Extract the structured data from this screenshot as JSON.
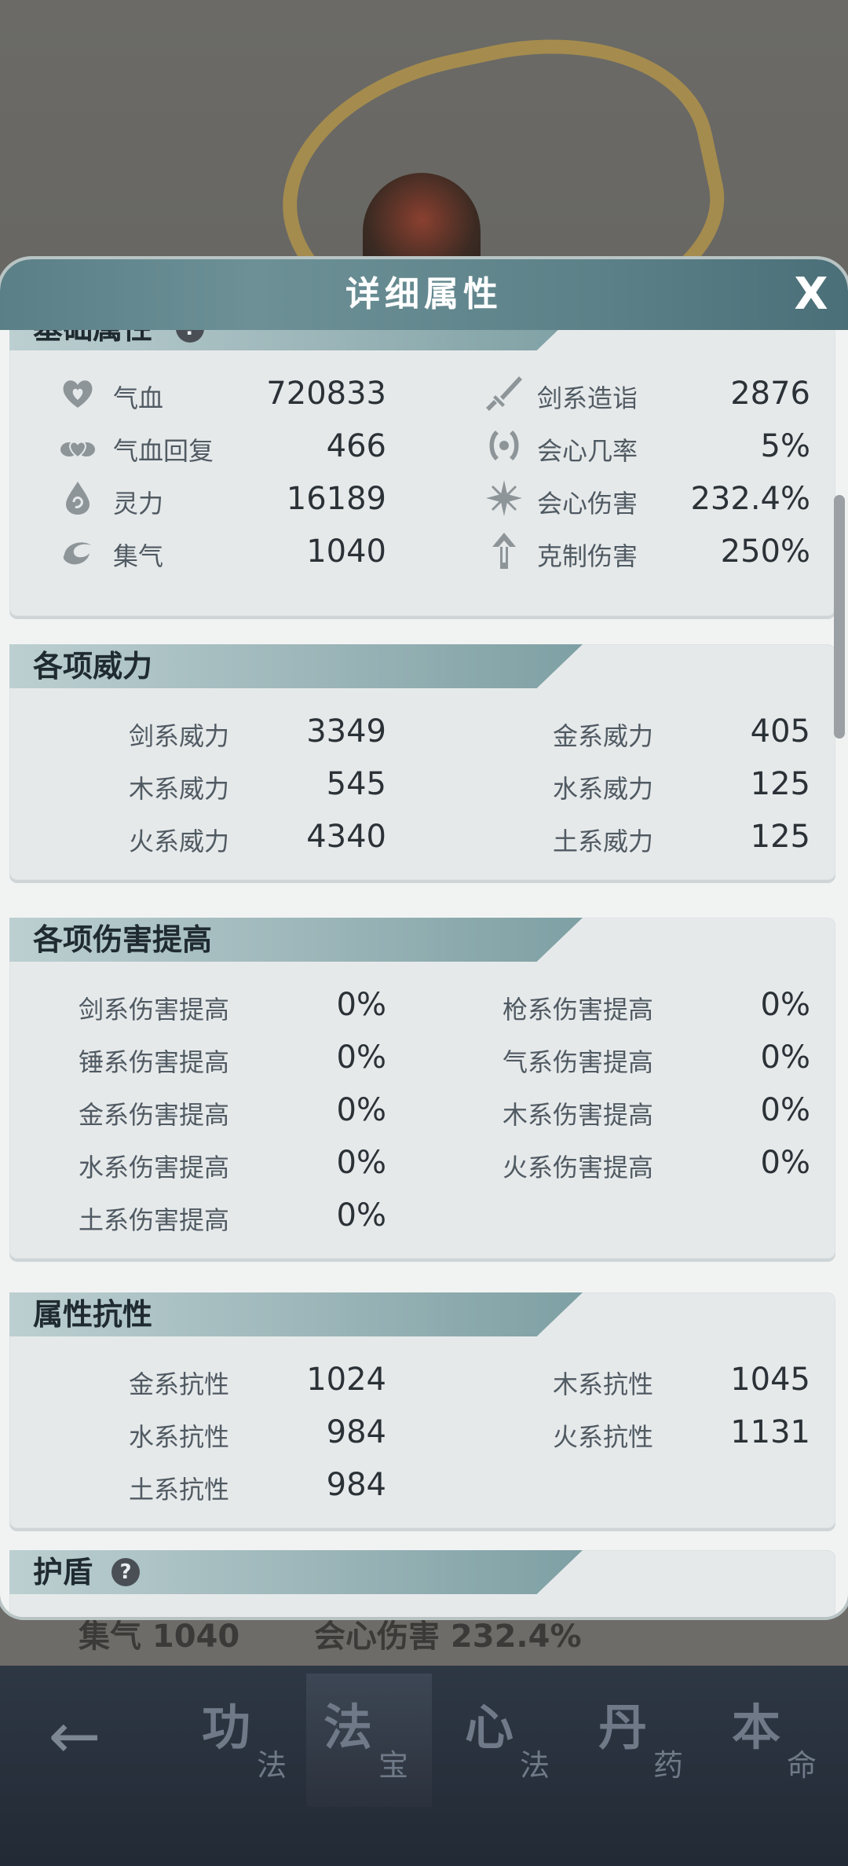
{
  "modal": {
    "title": "详细属性",
    "close": "X"
  },
  "basic": {
    "title": "基础属性",
    "help": "?",
    "left": [
      {
        "icon": "heart-icon",
        "label": "气血",
        "value": "720833"
      },
      {
        "icon": "cloud-heart-icon",
        "label": "气血回复",
        "value": "466"
      },
      {
        "icon": "spirit-drop-icon",
        "label": "灵力",
        "value": "16189"
      },
      {
        "icon": "swirl-icon",
        "label": "集气",
        "value": "1040"
      }
    ],
    "right": [
      {
        "icon": "sword-icon",
        "label": "剑系造诣",
        "value": "2876"
      },
      {
        "icon": "crit-rate-icon",
        "label": "会心几率",
        "value": "5%"
      },
      {
        "icon": "crit-damage-icon",
        "label": "会心伤害",
        "value": "232.4%"
      },
      {
        "icon": "counter-arrow-icon",
        "label": "克制伤害",
        "value": "250%"
      }
    ]
  },
  "power": {
    "title": "各项威力",
    "left": [
      {
        "label": "剑系威力",
        "value": "3349"
      },
      {
        "label": "木系威力",
        "value": "545"
      },
      {
        "label": "火系威力",
        "value": "4340"
      }
    ],
    "right": [
      {
        "label": "金系威力",
        "value": "405"
      },
      {
        "label": "水系威力",
        "value": "125"
      },
      {
        "label": "土系威力",
        "value": "125"
      }
    ]
  },
  "damage": {
    "title": "各项伤害提高",
    "left": [
      {
        "label": "剑系伤害提高",
        "value": "0%"
      },
      {
        "label": "锤系伤害提高",
        "value": "0%"
      },
      {
        "label": "金系伤害提高",
        "value": "0%"
      },
      {
        "label": "水系伤害提高",
        "value": "0%"
      },
      {
        "label": "土系伤害提高",
        "value": "0%"
      }
    ],
    "right": [
      {
        "label": "枪系伤害提高",
        "value": "0%"
      },
      {
        "label": "气系伤害提高",
        "value": "0%"
      },
      {
        "label": "木系伤害提高",
        "value": "0%"
      },
      {
        "label": "火系伤害提高",
        "value": "0%"
      }
    ]
  },
  "resist": {
    "title": "属性抗性",
    "left": [
      {
        "label": "金系抗性",
        "value": "1024"
      },
      {
        "label": "水系抗性",
        "value": "984"
      },
      {
        "label": "土系抗性",
        "value": "984"
      }
    ],
    "right": [
      {
        "label": "木系抗性",
        "value": "1045"
      },
      {
        "label": "火系抗性",
        "value": "1131"
      }
    ]
  },
  "shield": {
    "title": "护盾",
    "help": "?"
  },
  "background": {
    "strip_left": "集气 1040",
    "strip_right": "会心伤害 232.4%"
  },
  "nav": {
    "tabs": [
      {
        "big": "功",
        "small": "法"
      },
      {
        "big": "法",
        "small": "宝"
      },
      {
        "big": "心",
        "small": "法"
      },
      {
        "big": "丹",
        "small": "药"
      },
      {
        "big": "本",
        "small": "命"
      }
    ]
  }
}
